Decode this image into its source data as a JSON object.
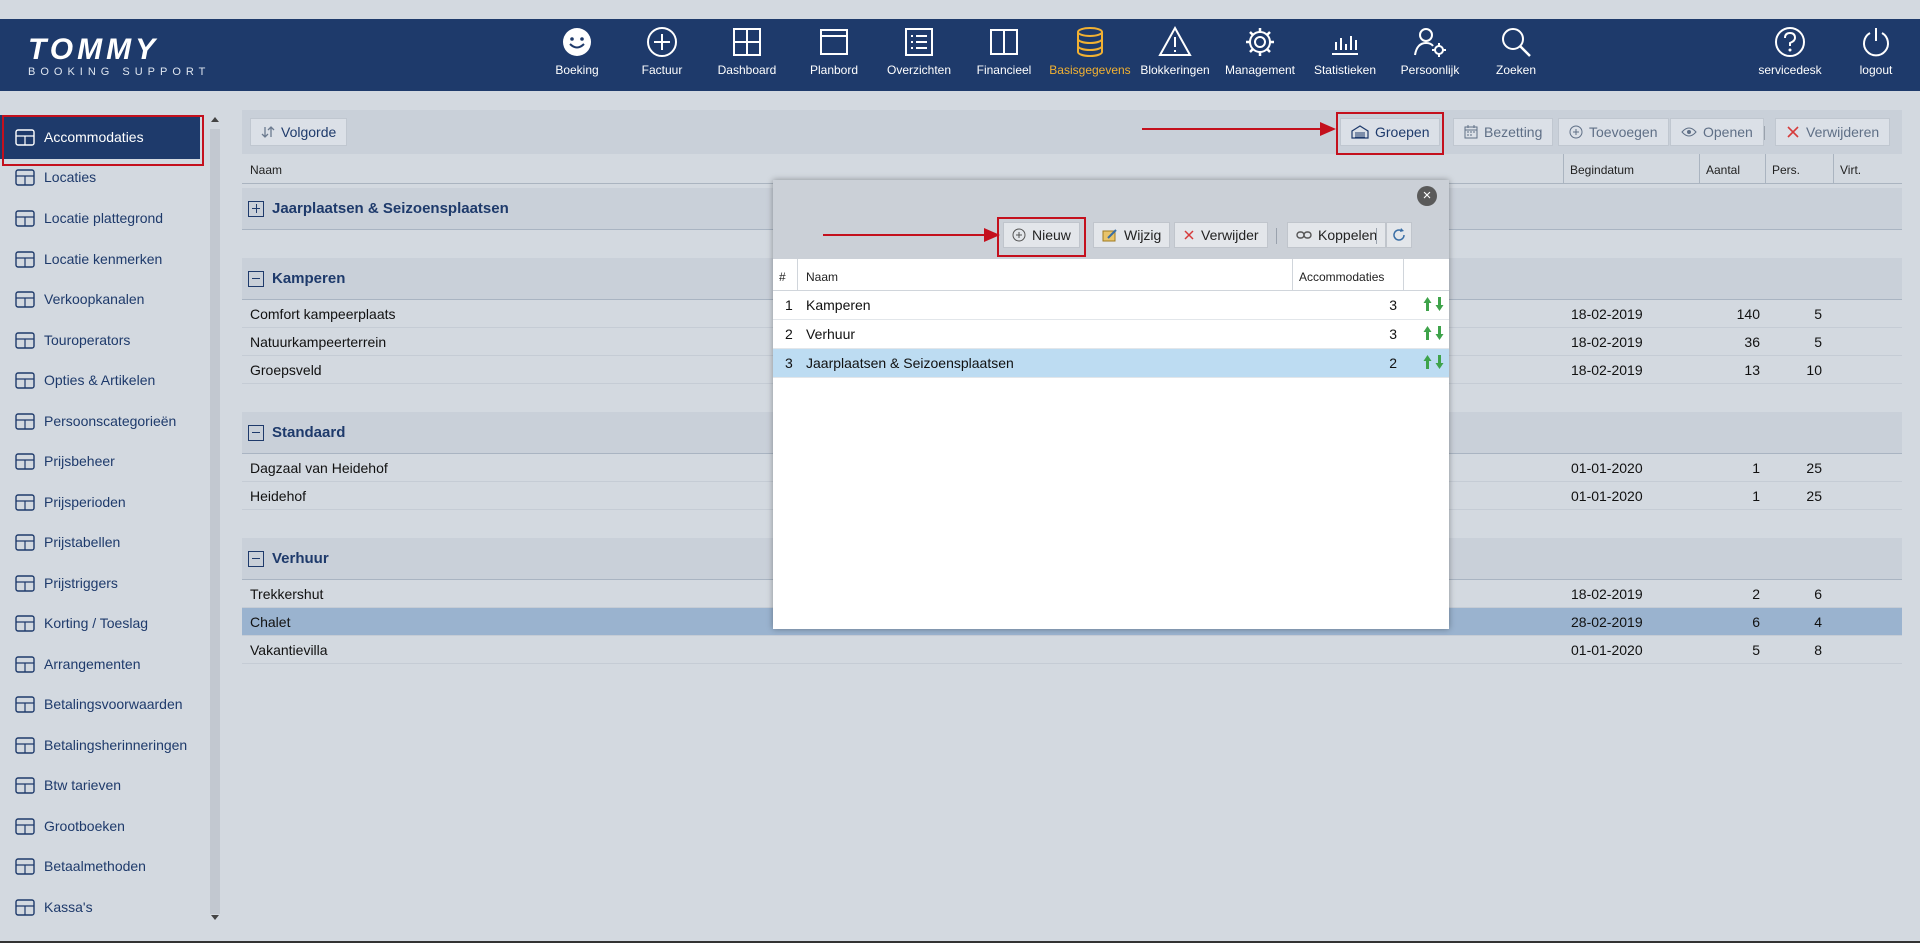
{
  "app": {
    "logo_main": "TOMMY",
    "logo_sub": "BOOKING SUPPORT",
    "accent_color": "#f2b132",
    "brand_color": "#1e3a6b"
  },
  "nav": [
    {
      "label": "Boeking",
      "icon": "smiley-icon"
    },
    {
      "label": "Factuur",
      "icon": "plus-circle-icon"
    },
    {
      "label": "Dashboard",
      "icon": "grid-icon"
    },
    {
      "label": "Planbord",
      "icon": "board-icon"
    },
    {
      "label": "Overzichten",
      "icon": "list-icon"
    },
    {
      "label": "Financieel",
      "icon": "book-icon"
    },
    {
      "label": "Basisgegevens",
      "icon": "database-icon",
      "active": true
    },
    {
      "label": "Blokkeringen",
      "icon": "warning-icon"
    },
    {
      "label": "Management",
      "icon": "gear-icon"
    },
    {
      "label": "Statistieken",
      "icon": "bar-chart-icon"
    },
    {
      "label": "Persoonlijk",
      "icon": "user-gear-icon"
    },
    {
      "label": "Zoeken",
      "icon": "search-icon"
    },
    {
      "label": "servicedesk",
      "icon": "help-icon"
    },
    {
      "label": "logout",
      "icon": "power-icon"
    }
  ],
  "sidebar": {
    "items": [
      {
        "label": "Accommodaties",
        "icon": "building-icon",
        "active": true
      },
      {
        "label": "Locaties",
        "icon": "location-pin-icon"
      },
      {
        "label": "Locatie plattegrond",
        "icon": "map-icon"
      },
      {
        "label": "Locatie kenmerken",
        "icon": "location-info-icon"
      },
      {
        "label": "Verkoopkanalen",
        "icon": "share-icon"
      },
      {
        "label": "Touroperators",
        "icon": "megaphone-icon"
      },
      {
        "label": "Opties & Artikelen",
        "icon": "boxes-icon"
      },
      {
        "label": "Persoonscategorieën",
        "icon": "people-icon"
      },
      {
        "label": "Prijsbeheer",
        "icon": "abacus-icon"
      },
      {
        "label": "Prijsperioden",
        "icon": "calendar-edit-icon"
      },
      {
        "label": "Prijstabellen",
        "icon": "table-icon"
      },
      {
        "label": "Prijstriggers",
        "icon": "exclamation-icon"
      },
      {
        "label": "Korting / Toeslag",
        "icon": "percent-icon"
      },
      {
        "label": "Arrangementen",
        "icon": "gift-icon"
      },
      {
        "label": "Betalingsvoorwaarden",
        "icon": "dollar-icon"
      },
      {
        "label": "Betalingsherinneringen",
        "icon": "bell-icon"
      },
      {
        "label": "Btw tarieven",
        "icon": "building-tall-icon"
      },
      {
        "label": "Grootboeken",
        "icon": "list-numbered-icon"
      },
      {
        "label": "Betaalmethoden",
        "icon": "credit-card-icon"
      },
      {
        "label": "Kassa's",
        "icon": "register-icon"
      }
    ]
  },
  "toolbar": {
    "sort": "Volgorde",
    "groups": "Groepen",
    "occupancy": "Bezetting",
    "add": "Toevoegen",
    "open": "Openen",
    "delete": "Verwijderen"
  },
  "table": {
    "columns": [
      "Naam",
      "Begindatum",
      "Aantal",
      "Pers.",
      "Virt."
    ],
    "groups": [
      {
        "name": "Jaarplaatsen & Seizoensplaatsen",
        "collapsed": true,
        "rows": []
      },
      {
        "name": "Kamperen",
        "collapsed": false,
        "rows": [
          {
            "name": "Comfort kampeerplaats",
            "date": "18-02-2019",
            "count": "140",
            "pers": "5"
          },
          {
            "name": "Natuurkampeerterrein",
            "date": "18-02-2019",
            "count": "36",
            "pers": "5"
          },
          {
            "name": "Groepsveld",
            "date": "18-02-2019",
            "count": "13",
            "pers": "10"
          }
        ]
      },
      {
        "name": "Standaard",
        "collapsed": false,
        "rows": [
          {
            "name": "Dagzaal van Heidehof",
            "date": "01-01-2020",
            "count": "1",
            "pers": "25"
          },
          {
            "name": "Heidehof",
            "date": "01-01-2020",
            "count": "1",
            "pers": "25"
          }
        ]
      },
      {
        "name": "Verhuur",
        "collapsed": false,
        "rows": [
          {
            "name": "Trekkershut",
            "date": "18-02-2019",
            "count": "2",
            "pers": "6"
          },
          {
            "name": "Chalet",
            "date": "28-02-2019",
            "count": "6",
            "pers": "4",
            "selected": true
          },
          {
            "name": "Vakantievilla",
            "date": "01-01-2020",
            "count": "5",
            "pers": "8"
          }
        ]
      }
    ]
  },
  "dialog": {
    "buttons": {
      "new": "Nieuw",
      "edit": "Wijzig",
      "delete": "Verwijder",
      "link": "Koppelen"
    },
    "columns": [
      "#",
      "Naam",
      "Accommodaties"
    ],
    "rows": [
      {
        "num": "1",
        "name": "Kamperen",
        "count": "3"
      },
      {
        "num": "2",
        "name": "Verhuur",
        "count": "3"
      },
      {
        "num": "3",
        "name": "Jaarplaatsen & Seizoensplaatsen",
        "count": "2",
        "selected": true
      }
    ]
  }
}
